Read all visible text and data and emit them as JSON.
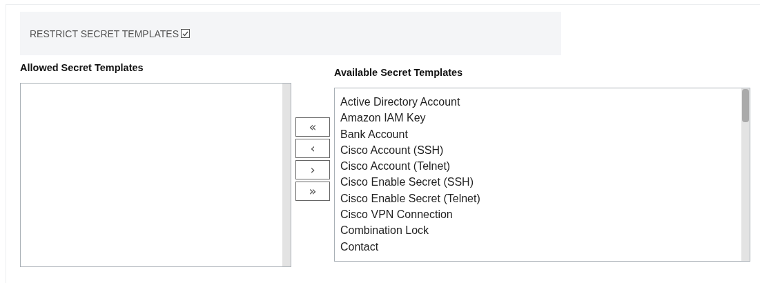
{
  "header": {
    "label": "RESTRICT SECRET TEMPLATES",
    "checked": true
  },
  "allowed": {
    "title": "Allowed Secret Templates"
  },
  "move_buttons": [
    "«",
    "‹",
    "›",
    "»"
  ],
  "available": {
    "title": "Available Secret Templates",
    "items": [
      "Active Directory Account",
      "Amazon IAM Key",
      "Bank Account",
      "Cisco Account (SSH)",
      "Cisco Account (Telnet)",
      "Cisco Enable Secret (SSH)",
      "Cisco Enable Secret (Telnet)",
      "Cisco VPN Connection",
      "Combination Lock",
      "Contact"
    ]
  }
}
